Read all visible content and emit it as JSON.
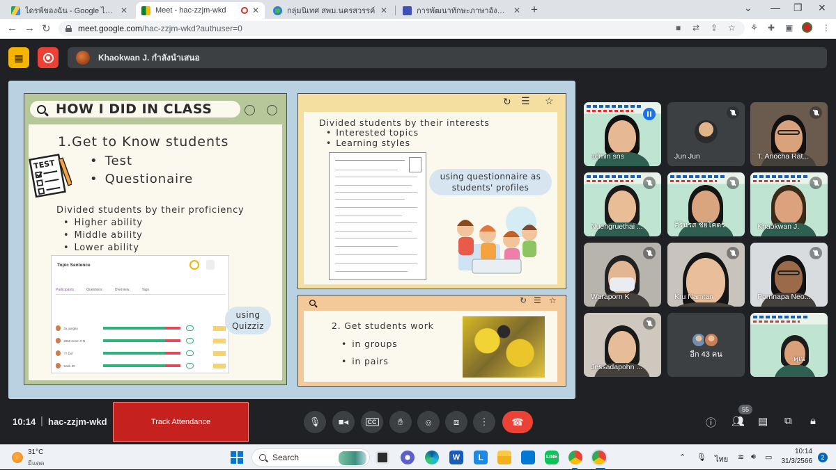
{
  "browser": {
    "tabs": [
      {
        "title": "ไดรฟ์ของฉัน - Google ไดรฟ์",
        "active": false
      },
      {
        "title": "Meet - hac-zzjm-wkd",
        "active": true
      },
      {
        "title": "กลุ่มนิเทศ สพม.นครสวรรค์",
        "active": false
      },
      {
        "title": "การพัฒนาทักษะภาษาอังกฤษ English",
        "active": false
      }
    ],
    "url_host": "meet.google.com",
    "url_path": "/hac-zzjm-wkd?authuser=0"
  },
  "meet": {
    "presenter_label": "Khaokwan J. กำลังนำเสนอ",
    "clock": "10:14",
    "separator": "|",
    "meeting_code": "hac-zzjm-wkd",
    "track_attendance": "Track Attendance",
    "participant_count": "55"
  },
  "slide": {
    "search_title": "HOW I DID IN CLASS",
    "heading": "1.Get to Know students",
    "big_bullets": [
      "Test",
      "Questionaire"
    ],
    "test_label": "TEST",
    "proficiency_heading": "Divided students by their proficiency",
    "proficiency_bullets": [
      "Higher ability",
      "Middle ability",
      "Lower ability"
    ],
    "quiz_title": "Topic Sentence",
    "quiz_tabs": [
      "Participants",
      "Questions",
      "Overview",
      "Tags"
    ],
    "quiz_students": [
      "Ja_jungko",
      "2065 mmm # Nyan 125",
      "?? Dof",
      "Sarik 20"
    ],
    "quizziz_bubble": [
      "using",
      "Quizziz"
    ],
    "interests_heading": "Divided students by their interests",
    "interests_bullets": [
      "Interested topics",
      "Learning styles"
    ],
    "questionnaire_bubble": [
      "using questionnaire as",
      "students' profiles"
    ],
    "work_heading": "2. Get students work",
    "work_bullets": [
      "in groups",
      "in pairs"
    ]
  },
  "participants": [
    {
      "name": "admin sns",
      "state": "speaking"
    },
    {
      "name": "Jun Jun",
      "state": "muted"
    },
    {
      "name": "T. Anocha Rat...",
      "state": "muted"
    },
    {
      "name": "Nuengruethai ...",
      "state": "muted"
    },
    {
      "name": "ศิรินรส ชัยโคตร",
      "state": "muted"
    },
    {
      "name": "Khaokwan J.",
      "state": "muted"
    },
    {
      "name": "Waraporn K",
      "state": "muted"
    },
    {
      "name": "Kru Namtan",
      "state": "muted"
    },
    {
      "name": "Pornnapa Neo...",
      "state": "muted"
    },
    {
      "name": "Jessadapohn ...",
      "state": "muted"
    },
    {
      "name": "อีก 43 คน",
      "state": "group"
    },
    {
      "name": "คุณ",
      "state": "self"
    }
  ],
  "taskbar": {
    "temperature": "31°C",
    "weather": "มีแดด",
    "search_label": "Search",
    "language": "ไทย",
    "time": "10:14",
    "date": "31/3/2566",
    "notifications": "2"
  },
  "colors": {
    "meet_bg": "#202124",
    "end_call": "#ea4335",
    "track_button": "#c5221f",
    "slide_bg": "#b9d2e2"
  }
}
